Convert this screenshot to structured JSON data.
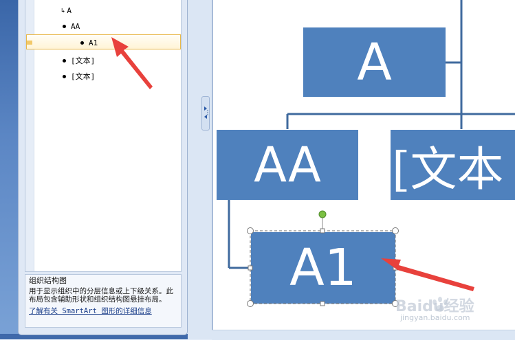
{
  "text_pane": {
    "items": [
      {
        "label": "A",
        "marker": "arrow"
      },
      {
        "label": "AA",
        "marker": "bullet"
      },
      {
        "label": "A1",
        "marker": "bullet",
        "selected": true
      },
      {
        "label": "[文本]",
        "marker": "bullet"
      },
      {
        "label": "[文本]",
        "marker": "bullet"
      }
    ],
    "description_title": "组织结构图",
    "description_body": "用于显示组织中的分层信息或上下级关系。此布局包含辅助形状和组织结构图悬挂布局。",
    "description_link": "了解有关 SmartArt 图形的详细信息"
  },
  "diagram": {
    "nodes": {
      "top": "A",
      "left": "AA",
      "right": "[文本",
      "selected": "A1"
    },
    "fill_color": "#4f81bd",
    "connector_color": "#3f6a9e"
  },
  "annotations": {
    "arrow_color": "#e8413c"
  },
  "watermark": {
    "brand": "Baidu经验",
    "url": "jingyan.baidu.com"
  }
}
